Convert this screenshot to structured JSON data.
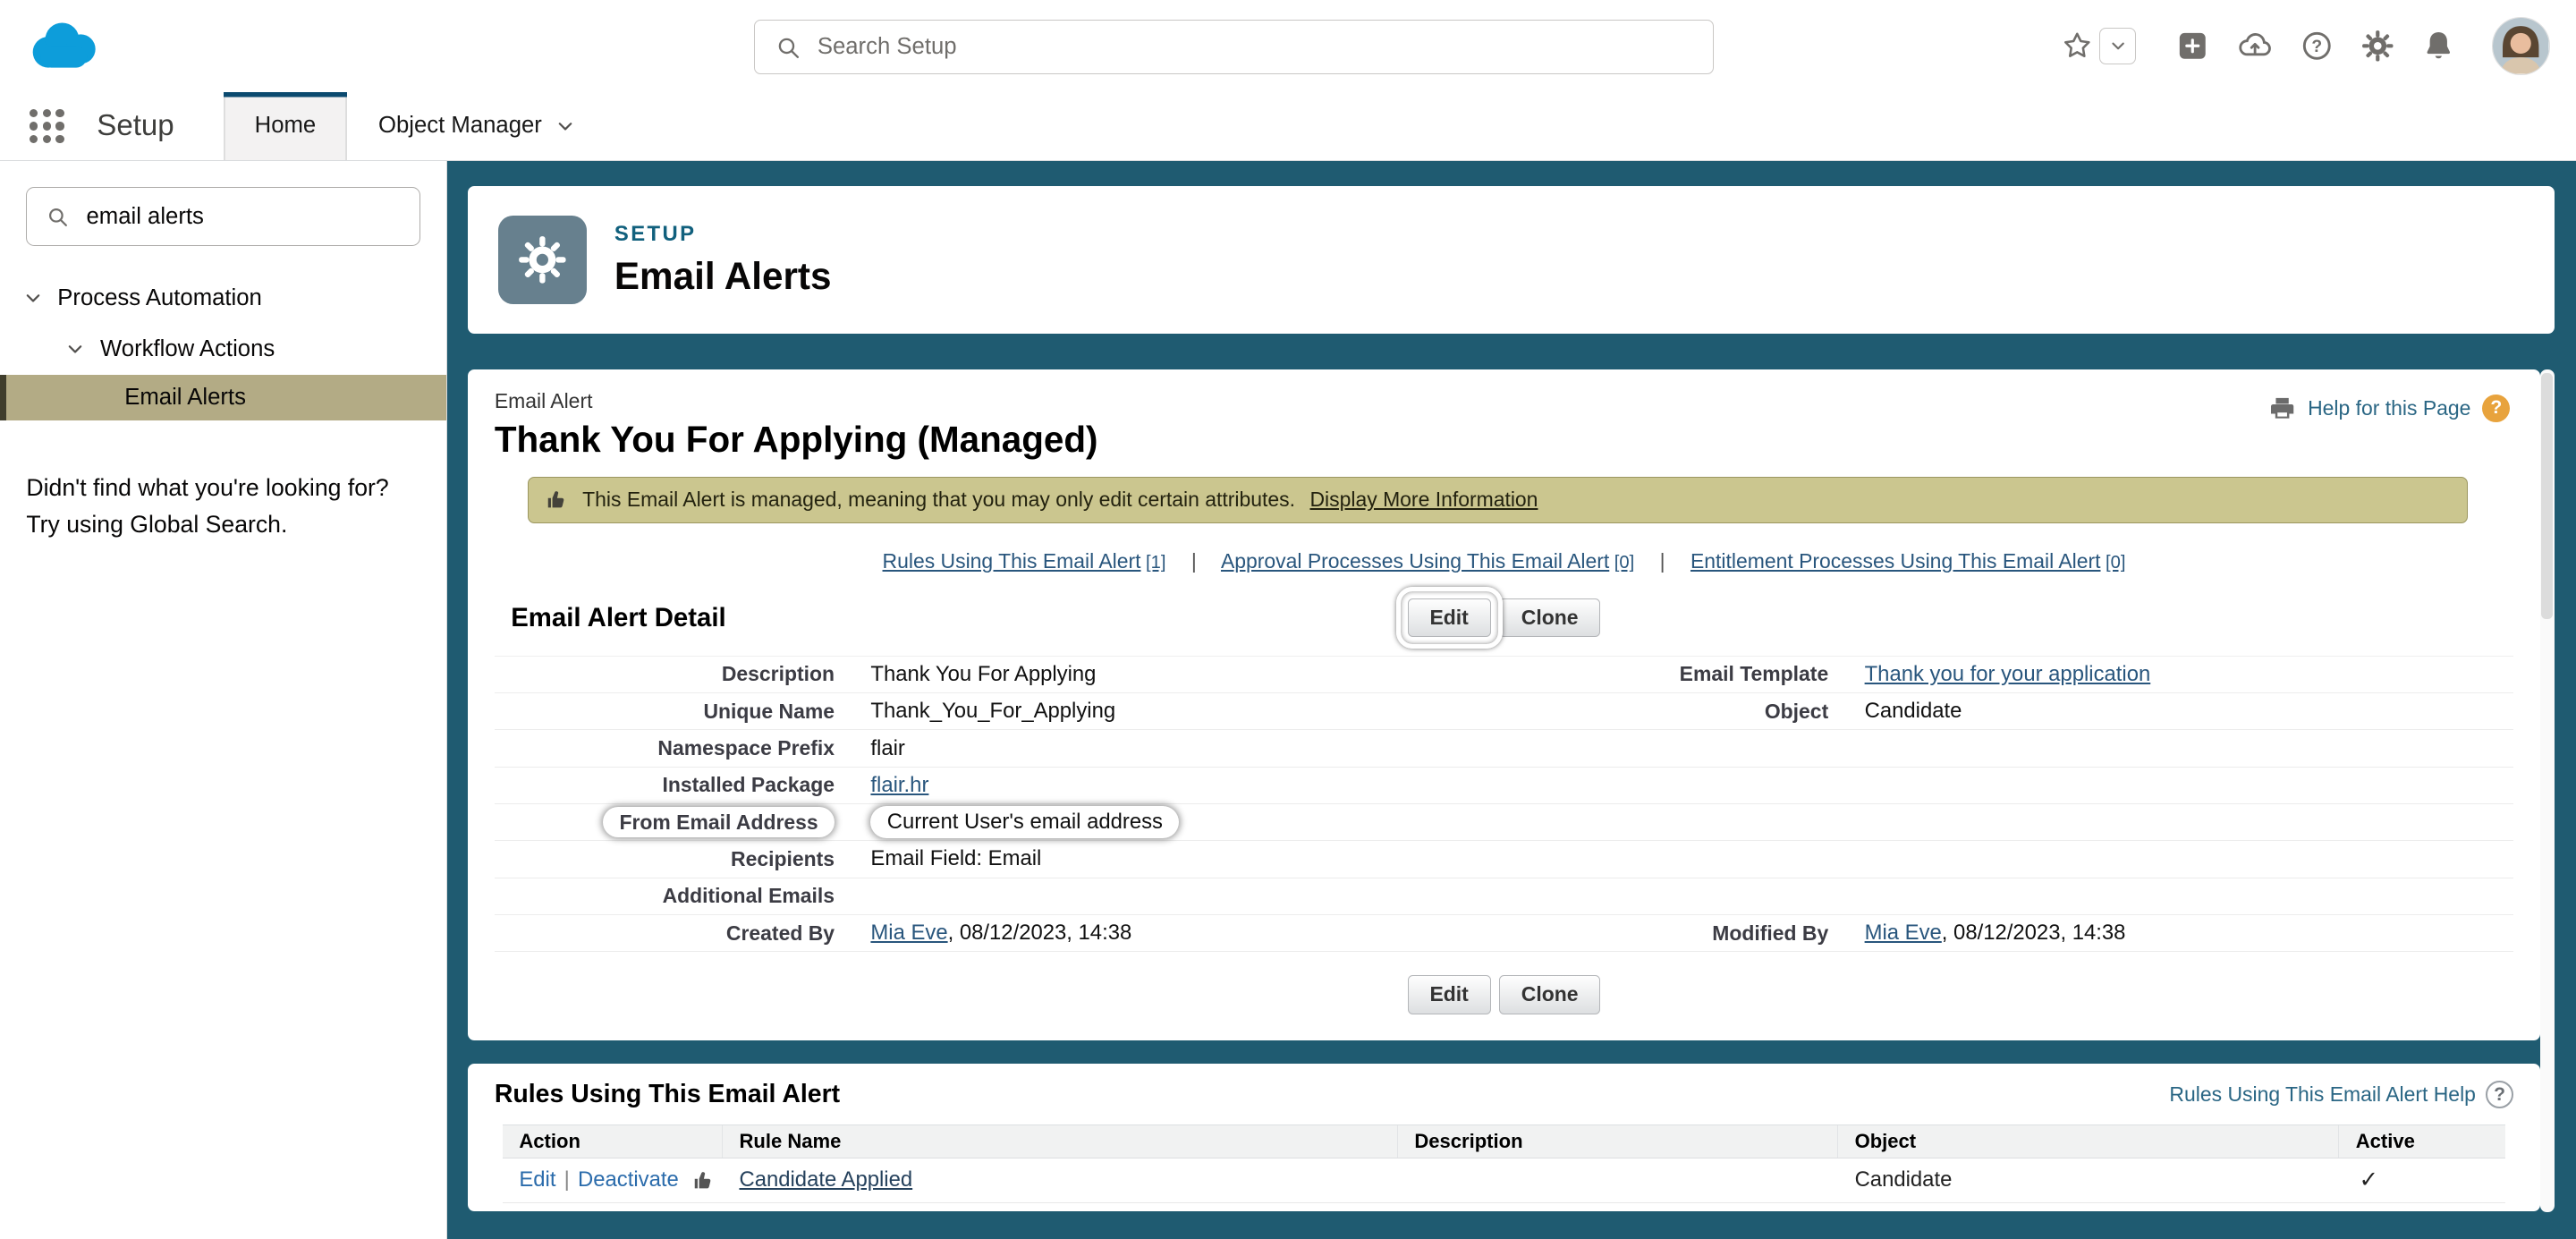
{
  "colors": {
    "app-bg": "#1f5b71",
    "selected-bg": "#b3ab85",
    "selected-bar": "#3f3d2c",
    "banner-bg": "#cbc68f",
    "banner-border": "#9b9660",
    "classic-link": "#29567d",
    "action-link": "#2a6bab",
    "icon-gray": "#706e6b",
    "tile-bg": "#67808e",
    "eyebrow": "#11607d",
    "tab-accent": "#0b4a6f",
    "help-orange": "#e8a33d",
    "logo-blue": "#0d9dda"
  },
  "icons": {
    "question_glyph": "?"
  },
  "global_header": {
    "search_placeholder": "Search Setup"
  },
  "nav": {
    "app_label": "Setup",
    "tabs": [
      {
        "label": "Home"
      },
      {
        "label": "Object Manager"
      }
    ]
  },
  "sidebar": {
    "quick_find_value": "email alerts",
    "items": [
      {
        "label": "Process Automation"
      },
      {
        "label": "Workflow Actions"
      },
      {
        "label": "Email Alerts"
      }
    ],
    "not_found_line1": "Didn't find what you're looking for?",
    "not_found_line2": "Try using Global Search."
  },
  "page_header": {
    "eyebrow": "SETUP",
    "title": "Email Alerts"
  },
  "detail": {
    "entity_label": "Email Alert",
    "title": "Thank You For Applying (Managed)",
    "help_link": "Help for this Page",
    "banner": {
      "text": "This Email Alert is managed, meaning that you may only edit certain attributes.",
      "link": "Display More Information"
    },
    "separator": "|",
    "cross_links": [
      {
        "label": "Rules Using This Email Alert",
        "count": "[1]"
      },
      {
        "label": "Approval Processes Using This Email Alert",
        "count": "[0]"
      },
      {
        "label": "Entitlement Processes Using This Email Alert",
        "count": "[0]"
      }
    ],
    "section_title": "Email Alert Detail",
    "edit_button": "Edit",
    "clone_button": "Clone",
    "rows": [
      {
        "l_label": "Description",
        "l_value": "Thank You For Applying",
        "r_label": "Email Template",
        "r_value": "Thank you for your application"
      },
      {
        "l_label": "Unique Name",
        "l_value": "Thank_You_For_Applying",
        "r_label": "Object",
        "r_value": "Candidate"
      },
      {
        "l_label": "Namespace Prefix",
        "l_value": "flair"
      },
      {
        "l_label": "Installed Package",
        "l_value": "flair.hr"
      },
      {
        "l_label": "From Email Address",
        "l_value": "Current User's email address"
      },
      {
        "l_label": "Recipients",
        "l_value": "Email Field: Email"
      },
      {
        "l_label": "Additional Emails",
        "l_value": ""
      },
      {
        "l_label": "Created By",
        "l_link": "Mia Eve",
        "l_rest": ", 08/12/2023, 14:38",
        "r_label": "Modified By",
        "r_link": "Mia Eve",
        "r_rest": ", 08/12/2023, 14:38"
      }
    ]
  },
  "related": {
    "title": "Rules Using This Email Alert",
    "help_link": "Rules Using This Email Alert Help",
    "columns": [
      "Action",
      "Rule Name",
      "Description",
      "Object",
      "Active"
    ],
    "row": {
      "action_edit": "Edit",
      "action_sep": "|",
      "action_deactivate": "Deactivate",
      "rule_name": "Candidate Applied",
      "description": "",
      "object": "Candidate",
      "active_mark": "✓"
    }
  }
}
